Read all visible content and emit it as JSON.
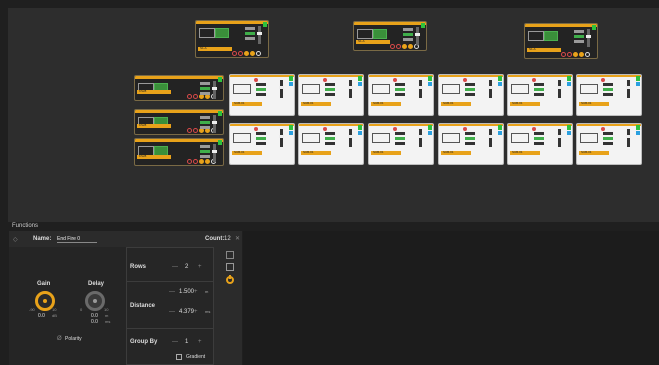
{
  "panel": {
    "title": "Functions",
    "name_label": "Name:",
    "name_value": "End Fire 0",
    "count_label": "Count:",
    "count_value": "12",
    "close_icon": "close-icon",
    "collapse_icon": "chevron-left-icon",
    "gain": {
      "label": "Gain",
      "min": "-90",
      "max": "10",
      "value": "0.0",
      "unit": "dB"
    },
    "delay": {
      "label": "Delay",
      "min": "0",
      "max": "10",
      "value_ms": "0.0",
      "value_m": "0.0",
      "unit_m": "m",
      "unit_ms": "ms"
    },
    "polarity_label": "Polarity",
    "rows": {
      "rows_label": "Rows",
      "rows_value": "2",
      "distance_label": "Distance",
      "distance_m": "1.500",
      "distance_m_unit": "m",
      "distance_ms": "4.379",
      "distance_ms_unit": "ms",
      "group_by_label": "Group By",
      "group_by_value": "1",
      "gradient_label": "Gradient"
    },
    "minus": "—",
    "plus": "+",
    "accent": "#e8a21a"
  },
  "devices": {
    "top_row_count": 3,
    "amp_label": "S1-A",
    "speaker_label": "SUB-01",
    "sub_label": "KS28"
  }
}
